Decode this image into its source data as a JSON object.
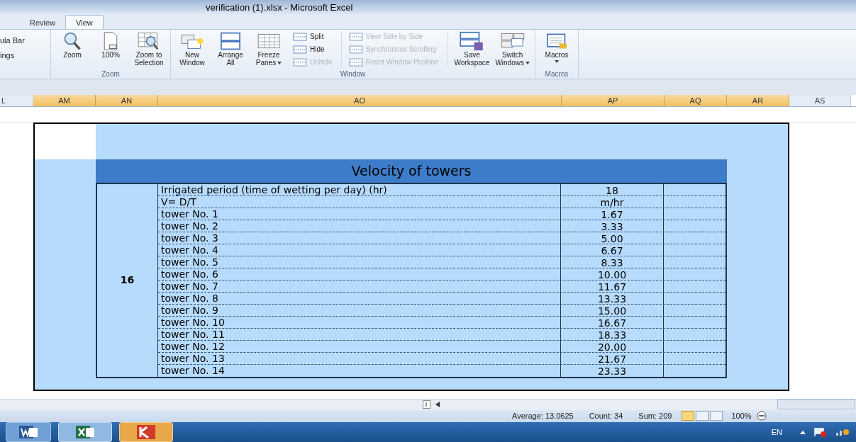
{
  "window": {
    "title": "verification (1).xlsx  -  Microsoft Excel"
  },
  "tabs": [
    {
      "label": "Review",
      "selected": false
    },
    {
      "label": "View",
      "selected": true
    }
  ],
  "ribbon": {
    "cut_items": [
      "ula Bar",
      "ings"
    ],
    "groups": [
      {
        "label": "Zoom",
        "items": [
          {
            "kind": "large",
            "lines": [
              "Zoom"
            ],
            "dropdown": false
          },
          {
            "kind": "large",
            "lines": [
              "100%"
            ],
            "dropdown": false
          },
          {
            "kind": "large",
            "lines": [
              "Zoom to",
              "Selection"
            ],
            "dropdown": false
          }
        ]
      },
      {
        "label": "Window",
        "items": [
          {
            "kind": "large",
            "lines": [
              "New",
              "Window"
            ],
            "dropdown": false
          },
          {
            "kind": "large",
            "lines": [
              "Arrange",
              "All"
            ],
            "dropdown": false
          },
          {
            "kind": "large",
            "lines": [
              "Freeze",
              "Panes"
            ],
            "dropdown": true
          },
          {
            "kind": "stack",
            "entries": [
              {
                "label": "Split",
                "disabled": false
              },
              {
                "label": "Hide",
                "disabled": false
              },
              {
                "label": "Unhide",
                "disabled": true
              }
            ]
          },
          {
            "kind": "stack",
            "entries": [
              {
                "label": "View Side by Side",
                "disabled": true
              },
              {
                "label": "Synchronous Scrolling",
                "disabled": true
              },
              {
                "label": "Reset Window Position",
                "disabled": true
              }
            ]
          },
          {
            "kind": "large",
            "lines": [
              "Save",
              "Workspace"
            ],
            "dropdown": false
          },
          {
            "kind": "large",
            "lines": [
              "Switch",
              "Windows"
            ],
            "dropdown": true
          }
        ]
      },
      {
        "label": "Macros",
        "items": [
          {
            "kind": "large",
            "lines": [
              "Macros"
            ],
            "dropdown": true
          }
        ]
      }
    ]
  },
  "columns": [
    {
      "label": "L",
      "selected": false
    },
    {
      "label": "AM",
      "selected": true
    },
    {
      "label": "AN",
      "selected": true
    },
    {
      "label": "AO",
      "selected": true
    },
    {
      "label": "AP",
      "selected": true
    },
    {
      "label": "AQ",
      "selected": true
    },
    {
      "label": "AR",
      "selected": true
    },
    {
      "label": "AS",
      "selected": false
    }
  ],
  "table": {
    "title": "Velocity of towers",
    "merged_cell": "16",
    "rows": [
      {
        "label": "Irrigated period (time of wetting per day) (hr)",
        "value": "18"
      },
      {
        "label": "V= D/T",
        "value": "m/hr"
      },
      {
        "label": "tower No. 1",
        "value": "1.67"
      },
      {
        "label": "tower No. 2",
        "value": "3.33"
      },
      {
        "label": "tower No. 3",
        "value": "5.00"
      },
      {
        "label": "tower No. 4",
        "value": "6.67"
      },
      {
        "label": "tower No. 5",
        "value": "8.33"
      },
      {
        "label": "tower No. 6",
        "value": "10.00"
      },
      {
        "label": "tower No. 7",
        "value": "11.67"
      },
      {
        "label": "tower No. 8",
        "value": "13.33"
      },
      {
        "label": "tower No. 9",
        "value": "15.00"
      },
      {
        "label": "tower No. 10",
        "value": "16.67"
      },
      {
        "label": "tower No. 11",
        "value": "18.33"
      },
      {
        "label": "tower No. 12",
        "value": "20.00"
      },
      {
        "label": "tower No. 13",
        "value": "21.67"
      },
      {
        "label": "tower No. 14",
        "value": "23.33"
      }
    ]
  },
  "status_bar": {
    "average": "Average: 13.0625",
    "count": "Count: 34",
    "sum": "Sum: 209",
    "views": [
      {
        "selected": true
      },
      {
        "selected": false
      },
      {
        "selected": false
      }
    ],
    "zoom": "100%"
  },
  "taskbar": {
    "language": "EN"
  }
}
